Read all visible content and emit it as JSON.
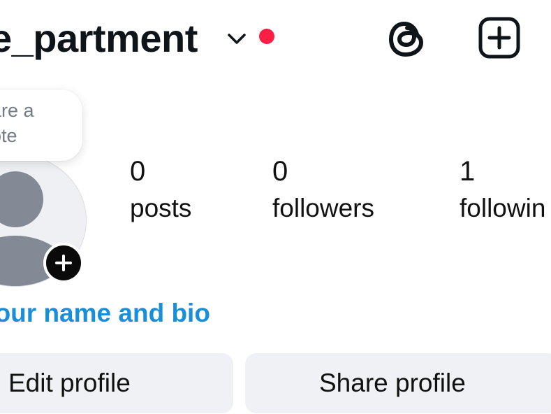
{
  "header": {
    "username": "e_partment",
    "notification_color": "#ff1f44",
    "icons": [
      "chevron-down-icon",
      "threads-icon",
      "create-post-icon"
    ]
  },
  "note": {
    "placeholder": "hare a\nnote"
  },
  "stats": [
    {
      "value": "0",
      "label": "posts"
    },
    {
      "value": "0",
      "label": "followers"
    },
    {
      "value": "1",
      "label": "followin"
    }
  ],
  "bio": {
    "link_text": "your name and bio",
    "link_color": "#1a8fd8"
  },
  "actions": {
    "edit_label": "Edit profile",
    "share_label": "Share profile"
  }
}
